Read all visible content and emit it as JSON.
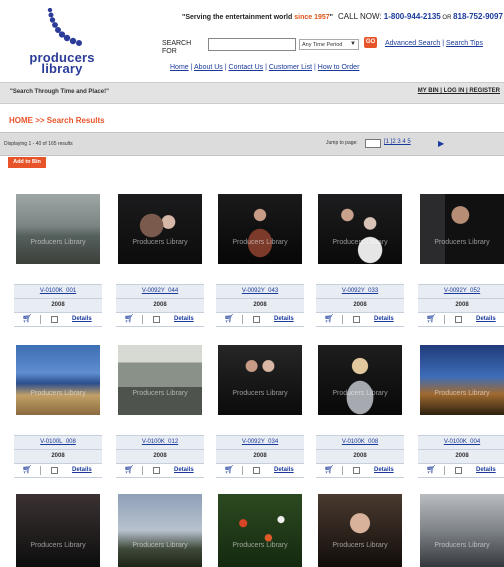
{
  "header": {
    "logo_text": "producers library",
    "tagline_pre": "\"Serving the entertainment world ",
    "tagline_since": "since 1957",
    "tagline_post": "\"",
    "call_label": "CALL NOW: ",
    "phone1": "1-800-944-2135",
    "or_text": " OR ",
    "phone2": "818-752-9097",
    "search_label": "SEARCH FOR",
    "search_value": "",
    "period_selected": "Any Time Period",
    "go_label": "GO",
    "advanced_search": "Advanced Search",
    "search_tips": "Search Tips",
    "nav": [
      "Home",
      "About Us",
      "Contact Us",
      "Customer List",
      "How to Order"
    ]
  },
  "bar": {
    "slogan": "\"Search Through Time and Place!\"",
    "account": "MY BIN | LOG IN | REGISTER"
  },
  "breadcrumb": "HOME >> Search Results",
  "results": {
    "displaying": "Displaying 1 - 40 of 165 results",
    "jump_label": "Jump to page:",
    "pages": "[1 ]2 3 4 5",
    "next_icon": "play-arrow-icon"
  },
  "add_to_bin": "Add to Bin",
  "watermark": "Producers Library",
  "details_label": "Details",
  "clips": [
    {
      "id": "V-0100K_001",
      "year": "2008",
      "scene": "beach-bird"
    },
    {
      "id": "V-0092Y_044",
      "year": "2008",
      "scene": "red-carpet-couple"
    },
    {
      "id": "V-0092Y_043",
      "year": "2008",
      "scene": "red-carpet-dress"
    },
    {
      "id": "V-0092Y_033",
      "year": "2008",
      "scene": "red-carpet-couple-2"
    },
    {
      "id": "V-0092Y_052",
      "year": "2008",
      "scene": "red-carpet-man"
    },
    {
      "id": "V-0100L_008",
      "year": "2008",
      "scene": "ocean-shore"
    },
    {
      "id": "V-0100K_012",
      "year": "2008",
      "scene": "street-building"
    },
    {
      "id": "V-0092Y_034",
      "year": "2008",
      "scene": "red-carpet-group"
    },
    {
      "id": "V-0100K_008",
      "year": "2008",
      "scene": "blonde-woman"
    },
    {
      "id": "V-0100K_004",
      "year": "2008",
      "scene": "church-sunset"
    },
    {
      "id": "",
      "year": "",
      "scene": "red-carpet-crowd"
    },
    {
      "id": "",
      "year": "",
      "scene": "lighthouse"
    },
    {
      "id": "",
      "year": "",
      "scene": "poppy-field"
    },
    {
      "id": "",
      "year": "",
      "scene": "woman-portrait"
    },
    {
      "id": "",
      "year": "",
      "scene": "city-street"
    }
  ],
  "colors": {
    "accent": "#e8542a",
    "link": "#1a3a9b",
    "bar": "#e3e3e3"
  }
}
